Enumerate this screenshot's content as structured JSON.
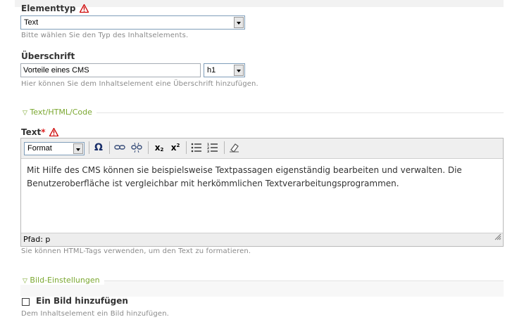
{
  "elementtyp": {
    "label": "Elementtyp",
    "selected": "Text",
    "help": "Bitte wählen Sie den Typ des Inhaltselements."
  },
  "ueberschrift": {
    "label": "Überschrift",
    "value": "Vorteile eines CMS",
    "level": "h1",
    "help": "Hier können Sie dem Inhaltselement eine Überschrift hinzufügen."
  },
  "section_text": {
    "legend": "Text/HTML/Code"
  },
  "text": {
    "label": "Text",
    "required_mark": "*",
    "format_select": "Format",
    "content_line1": "Mit Hilfe des CMS können sie beispielsweise Textpassagen eigenständig bearbeiten und verwalten. Die",
    "content_line2": "Benutzeroberfläche ist vergleichbar mit herkömmlichen Textverarbeitungsprogrammen.",
    "path": "Pfad: p",
    "help": "Sie können HTML-Tags verwenden, um den Text zu formatieren."
  },
  "section_bild": {
    "legend": "Bild-Einstellungen"
  },
  "bild": {
    "checkbox_label": "Ein Bild hinzufügen",
    "checked": false,
    "help": "Dem Inhaltselement ein Bild hinzufügen."
  },
  "toolbar_icons": [
    "omega-icon",
    "link-icon",
    "unlink-icon",
    "subscript-icon",
    "superscript-icon",
    "bullet-list-icon",
    "numbered-list-icon",
    "remove-format-icon"
  ],
  "colors": {
    "accent_green": "#7aa72f",
    "warning_red": "#d22",
    "required_red": "#dd2222"
  }
}
